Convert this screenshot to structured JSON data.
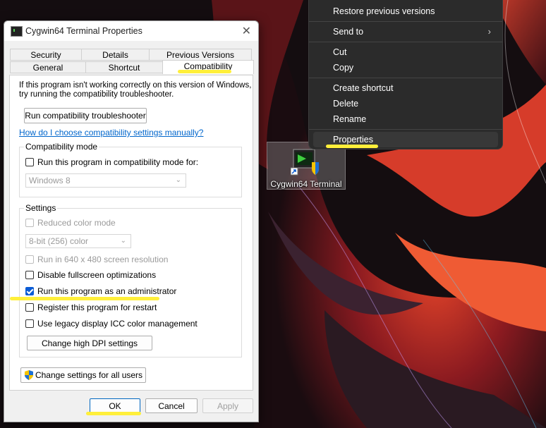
{
  "context_menu": {
    "items": [
      {
        "label": "Restore previous versions"
      },
      {
        "label": "Send to",
        "submenu_arrow": "›"
      },
      {
        "label": "Cut"
      },
      {
        "label": "Copy"
      },
      {
        "label": "Create shortcut"
      },
      {
        "label": "Delete"
      },
      {
        "label": "Rename"
      },
      {
        "label": "Properties"
      }
    ]
  },
  "desktop": {
    "icon_label": "Cygwin64 Terminal"
  },
  "dialog": {
    "title": "Cygwin64 Terminal Properties",
    "close_glyph": "✕",
    "tabs_row1": [
      "Security",
      "Details",
      "Previous Versions"
    ],
    "tabs_row2": [
      "General",
      "Shortcut",
      "Compatibility"
    ],
    "active_tab": "Compatibility",
    "intro_line1": "If this program isn't working correctly on this version of Windows,",
    "intro_line2": "try running the compatibility troubleshooter.",
    "troubleshooter_button": "Run compatibility troubleshooter",
    "help_link": "How do I choose compatibility settings manually?",
    "compat_mode": {
      "group_title": "Compatibility mode",
      "checkbox_label": "Run this program in compatibility mode for:",
      "checked": false,
      "os_value": "Windows 8"
    },
    "settings": {
      "group_title": "Settings",
      "reduced_color": {
        "label": "Reduced color mode",
        "checked": false,
        "enabled": false
      },
      "color_value": "8-bit (256) color",
      "res_640": {
        "label": "Run in 640 x 480 screen resolution",
        "checked": false,
        "enabled": false
      },
      "disable_fullscreen": {
        "label": "Disable fullscreen optimizations",
        "checked": false
      },
      "run_as_admin": {
        "label": "Run this program as an administrator",
        "checked": true
      },
      "register_restart": {
        "label": "Register this program for restart",
        "checked": false
      },
      "legacy_icc": {
        "label": "Use legacy display ICC color management",
        "checked": false
      },
      "dpi_button": "Change high DPI settings"
    },
    "all_users_button": "Change settings for all users",
    "ok_button": "OK",
    "cancel_button": "Cancel",
    "apply_button": "Apply"
  },
  "colors": {
    "highlight_marker": "#ffef3a",
    "checkbox_accent": "#0b5cd5",
    "link": "#0066cc",
    "menu_bg": "#2b2b2b"
  }
}
